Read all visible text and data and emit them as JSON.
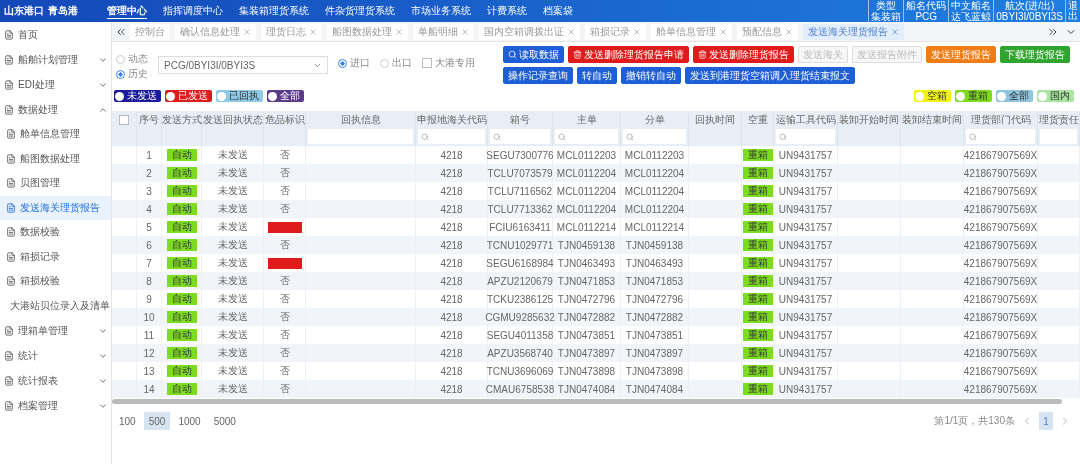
{
  "logo": {
    "primary": "山东港口",
    "secondary": "青岛港"
  },
  "top_nav": [
    {
      "label": "管理中心",
      "selected": true
    },
    {
      "label": "指挥调度中心",
      "selected": false
    },
    {
      "label": "集装箱理货系统",
      "selected": false
    },
    {
      "label": "件杂货理货系统",
      "selected": false
    },
    {
      "label": "市场业务系统",
      "selected": false
    },
    {
      "label": "计费系统",
      "selected": false
    },
    {
      "label": "档案袋",
      "selected": false
    }
  ],
  "vessel_info": {
    "headers": [
      "类型",
      "船名代码",
      "中文船名",
      "航次(进/出)"
    ],
    "values": [
      "集装箱",
      "PCG",
      "达飞蓝鲸",
      "0BYI3I/0BYI3S"
    ],
    "exit": "退出"
  },
  "sidebar": [
    {
      "label": "首页"
    },
    {
      "label": "船舶计划管理",
      "expanded": false
    },
    {
      "label": "EDI处理",
      "expanded": false
    },
    {
      "label": "数据处理",
      "expanded": true,
      "children": [
        {
          "label": "舱单信息管理",
          "selected": false
        },
        {
          "label": "船图数据处理",
          "selected": false
        },
        {
          "label": "贝图管理",
          "selected": false
        },
        {
          "label": "发送海关理货报告",
          "selected": true
        },
        {
          "label": "数据校验",
          "selected": false
        },
        {
          "label": "箱损记录",
          "selected": false
        },
        {
          "label": "箱损校验",
          "selected": false
        },
        {
          "label": "大港站贝位录入及清单",
          "selected": false
        }
      ]
    },
    {
      "label": "理箱单管理",
      "expanded": false
    },
    {
      "label": "统计",
      "expanded": false
    },
    {
      "label": "统计报表",
      "expanded": false
    },
    {
      "label": "档案管理",
      "expanded": false
    }
  ],
  "tabs": [
    {
      "label": "控制台",
      "selected": false,
      "closable": false
    },
    {
      "label": "确认信息处理",
      "selected": false,
      "closable": true
    },
    {
      "label": "理货日志",
      "selected": false,
      "closable": true
    },
    {
      "label": "船图数据处理",
      "selected": false,
      "closable": true
    },
    {
      "label": "单船明细",
      "selected": false,
      "closable": true
    },
    {
      "label": "国内空箱调拨出证",
      "selected": false,
      "closable": true
    },
    {
      "label": "箱损记录",
      "selected": false,
      "closable": true
    },
    {
      "label": "舱单信息管理",
      "selected": false,
      "closable": true
    },
    {
      "label": "预配信息",
      "selected": false,
      "closable": true
    },
    {
      "label": "发送海关理货报告",
      "selected": true,
      "closable": true
    }
  ],
  "filters": {
    "mode": [
      {
        "label": "动态",
        "selected": false
      },
      {
        "label": "历史",
        "selected": true
      }
    ],
    "voyage": "PCG/0BYI3I/0BYI3S",
    "direction": [
      {
        "label": "进口",
        "selected": true
      },
      {
        "label": "出口",
        "selected": false
      }
    ],
    "dagang": {
      "label": "大港专用",
      "checked": false
    }
  },
  "buttons": [
    {
      "label": "读取数据",
      "kind": "primary",
      "disabled": false,
      "has_icon": true
    },
    {
      "label": "发送删除理货报告申请",
      "kind": "danger",
      "disabled": false,
      "has_icon": true
    },
    {
      "label": "发送删除理货报告",
      "kind": "danger",
      "disabled": false,
      "has_icon": true
    },
    {
      "label": "发送海关",
      "kind": "primary",
      "disabled": true,
      "has_icon": false
    },
    {
      "label": "发送报告附件",
      "kind": "primary",
      "disabled": true,
      "has_icon": false
    },
    {
      "label": "发送理货报告",
      "kind": "warning",
      "disabled": false,
      "has_icon": false
    },
    {
      "label": "下载理货报告",
      "kind": "success",
      "disabled": false,
      "has_icon": false
    },
    {
      "label": "操作记录查询",
      "kind": "primary",
      "disabled": false,
      "has_icon": false
    },
    {
      "label": "转自动",
      "kind": "primary",
      "disabled": false,
      "has_icon": false
    },
    {
      "label": "撤销转自动",
      "kind": "primary",
      "disabled": false,
      "has_icon": false
    },
    {
      "label": "发送到港理货空箱调入理货结束报文",
      "kind": "primary",
      "disabled": false,
      "has_icon": false
    }
  ],
  "status_legend": [
    {
      "label": "未发送",
      "color": "#1a1a9c"
    },
    {
      "label": "已发送",
      "color": "#e01b1b"
    },
    {
      "label": "已回执",
      "color": "#8ecae6"
    },
    {
      "label": "全部",
      "color": "#5b3a8c"
    }
  ],
  "load_legend": [
    {
      "label": "空箱",
      "color": "#f2f218"
    },
    {
      "label": "重箱",
      "color": "#7ddc1f"
    },
    {
      "label": "全部",
      "color": "#8ec5dc"
    },
    {
      "label": "国内",
      "color": "#a8e6a0"
    }
  ],
  "table": {
    "header_checked": false,
    "columns": [
      {
        "label": "序号",
        "filter": false
      },
      {
        "label": "发送方式",
        "filter": false
      },
      {
        "label": "发送回执状态",
        "filter": false
      },
      {
        "label": "危品标识",
        "filter": false
      },
      {
        "label": "回执信息",
        "filter": true,
        "search": false
      },
      {
        "label": "申报地海关代码",
        "filter": true,
        "search": true
      },
      {
        "label": "箱号",
        "filter": true,
        "search": true
      },
      {
        "label": "主单",
        "filter": true,
        "search": true
      },
      {
        "label": "分单",
        "filter": true,
        "search": true
      },
      {
        "label": "回执时间",
        "filter": false
      },
      {
        "label": "空重",
        "filter": false
      },
      {
        "label": "运输工具代码",
        "filter": true,
        "search": true
      },
      {
        "label": "装卸开始时间",
        "filter": false
      },
      {
        "label": "装卸结束时间",
        "filter": false
      },
      {
        "label": "理货部门代码",
        "filter": true,
        "search": true
      },
      {
        "label": "理货责任",
        "filter": true,
        "search": false
      }
    ],
    "rows": [
      {
        "seq": "1",
        "mode": "自动",
        "status": "未发送",
        "dangerous": false,
        "danger": "否",
        "customs": "4218",
        "container": "SEGU7300776",
        "master": "MCL0112203",
        "house": "MCL0112203",
        "load": "重箱",
        "vessel": "UN9431757",
        "dept": "421867907569X"
      },
      {
        "seq": "2",
        "mode": "自动",
        "status": "未发送",
        "dangerous": false,
        "danger": "否",
        "customs": "4218",
        "container": "TCLU7073579",
        "master": "MCL0112204",
        "house": "MCL0112204",
        "load": "重箱",
        "vessel": "UN9431757",
        "dept": "421867907569X"
      },
      {
        "seq": "3",
        "mode": "自动",
        "status": "未发送",
        "dangerous": false,
        "danger": "否",
        "customs": "4218",
        "container": "TCLU7116562",
        "master": "MCL0112204",
        "house": "MCL0112204",
        "load": "重箱",
        "vessel": "UN9431757",
        "dept": "421867907569X"
      },
      {
        "seq": "4",
        "mode": "自动",
        "status": "未发送",
        "dangerous": false,
        "danger": "否",
        "customs": "4218",
        "container": "TCLU7713362",
        "master": "MCL0112204",
        "house": "MCL0112204",
        "load": "重箱",
        "vessel": "UN9431757",
        "dept": "421867907569X"
      },
      {
        "seq": "5",
        "mode": "自动",
        "status": "未发送",
        "dangerous": true,
        "customs": "4218",
        "container": "FCIU6163411",
        "master": "MCL0112214",
        "house": "MCL0112214",
        "load": "重箱",
        "vessel": "UN9431757",
        "dept": "421867907569X"
      },
      {
        "seq": "6",
        "mode": "自动",
        "status": "未发送",
        "dangerous": false,
        "danger": "否",
        "customs": "4218",
        "container": "TCNU1029771",
        "master": "TJN0459138",
        "house": "TJN0459138",
        "load": "重箱",
        "vessel": "UN9431757",
        "dept": "421867907569X"
      },
      {
        "seq": "7",
        "mode": "自动",
        "status": "未发送",
        "dangerous": true,
        "customs": "4218",
        "container": "SEGU6168984",
        "master": "TJN0463493",
        "house": "TJN0463493",
        "load": "重箱",
        "vessel": "UN9431757",
        "dept": "421867907569X"
      },
      {
        "seq": "8",
        "mode": "自动",
        "status": "未发送",
        "dangerous": false,
        "danger": "否",
        "customs": "4218",
        "container": "APZU2120679",
        "master": "TJN0471853",
        "house": "TJN0471853",
        "load": "重箱",
        "vessel": "UN9431757",
        "dept": "421867907569X"
      },
      {
        "seq": "9",
        "mode": "自动",
        "status": "未发送",
        "dangerous": false,
        "danger": "否",
        "customs": "4218",
        "container": "TCKU2386125",
        "master": "TJN0472796",
        "house": "TJN0472796",
        "load": "重箱",
        "vessel": "UN9431757",
        "dept": "421867907569X"
      },
      {
        "seq": "10",
        "mode": "自动",
        "status": "未发送",
        "dangerous": false,
        "danger": "否",
        "customs": "4218",
        "container": "CGMU9285632",
        "master": "TJN0472882",
        "house": "TJN0472882",
        "load": "重箱",
        "vessel": "UN9431757",
        "dept": "421867907569X"
      },
      {
        "seq": "11",
        "mode": "自动",
        "status": "未发送",
        "dangerous": false,
        "danger": "否",
        "customs": "4218",
        "container": "SEGU4011358",
        "master": "TJN0473851",
        "house": "TJN0473851",
        "load": "重箱",
        "vessel": "UN9431757",
        "dept": "421867907569X"
      },
      {
        "seq": "12",
        "mode": "自动",
        "status": "未发送",
        "dangerous": false,
        "danger": "否",
        "customs": "4218",
        "container": "APZU3568740",
        "master": "TJN0473897",
        "house": "TJN0473897",
        "load": "重箱",
        "vessel": "UN9431757",
        "dept": "421867907569X"
      },
      {
        "seq": "13",
        "mode": "自动",
        "status": "未发送",
        "dangerous": false,
        "danger": "否",
        "customs": "4218",
        "container": "TCNU3696069",
        "master": "TJN0473898",
        "house": "TJN0473898",
        "load": "重箱",
        "vessel": "UN9431757",
        "dept": "421867907569X"
      },
      {
        "seq": "14",
        "mode": "自动",
        "status": "未发送",
        "dangerous": false,
        "danger": "否",
        "customs": "4218",
        "container": "CMAU6758538",
        "master": "TJN0474084",
        "house": "TJN0474084",
        "load": "重箱",
        "vessel": "UN9431757",
        "dept": "421867907569X"
      }
    ]
  },
  "pager": {
    "sizes": [
      {
        "label": "100",
        "selected": false
      },
      {
        "label": "500",
        "selected": true
      },
      {
        "label": "1000",
        "selected": false
      },
      {
        "label": "5000",
        "selected": false
      }
    ],
    "summary": "第1/1页，共130条",
    "pages": [
      {
        "label": "1",
        "selected": true
      }
    ]
  }
}
